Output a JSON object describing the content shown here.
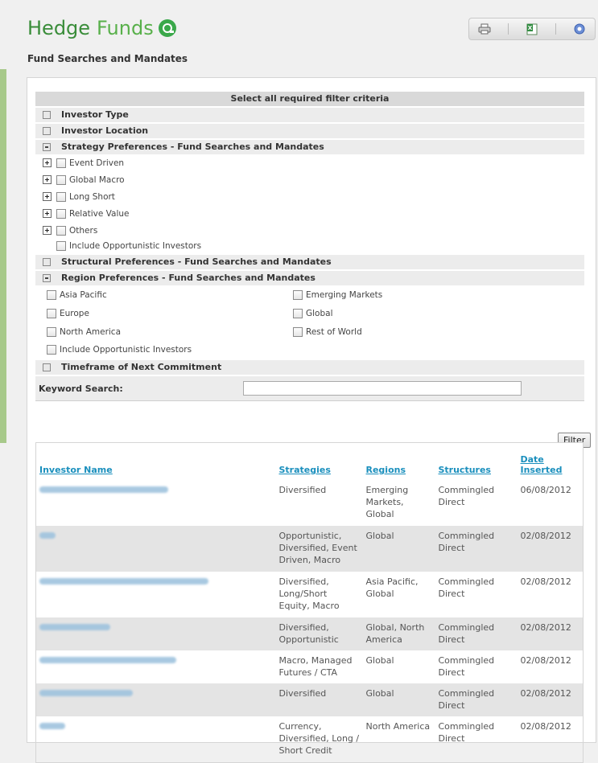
{
  "header": {
    "logo_main": "Hedge",
    "logo_light": "Funds",
    "subtitle": "Fund Searches and Mandates",
    "toolbar": {
      "print_icon": "printer-icon",
      "export_icon": "excel-icon",
      "help_icon": "help-icon"
    }
  },
  "filters": {
    "heading": "Select all required filter criteria",
    "investor_type": "Investor Type",
    "investor_location": "Investor Location",
    "strategy": {
      "label": "Strategy Preferences - Fund Searches and Mandates",
      "items": [
        "Event Driven",
        "Global Macro",
        "Long Short",
        "Relative Value",
        "Others"
      ],
      "include_opportunistic": "Include Opportunistic Investors"
    },
    "structural": "Structural Preferences - Fund Searches and Mandates",
    "region": {
      "label": "Region Preferences - Fund Searches and Mandates",
      "left": [
        "Asia Pacific",
        "Europe",
        "North America"
      ],
      "right": [
        "Emerging Markets",
        "Global",
        "Rest of World"
      ],
      "include_opportunistic": "Include Opportunistic Investors"
    },
    "timeframe": "Timeframe of Next Commitment",
    "keyword_label": "Keyword Search:",
    "keyword_value": "",
    "filter_button": "Filter"
  },
  "results": {
    "columns": [
      "Investor Name",
      "Strategies",
      "Regions",
      "Structures",
      "Date Inserted"
    ],
    "rows": [
      {
        "strategies": "Diversified",
        "regions": "Emerging Markets, Global",
        "structures": "Commingled Direct",
        "date": "06/08/2012"
      },
      {
        "strategies": "Opportunistic, Diversified, Event Driven, Macro",
        "regions": "Global",
        "structures": "Commingled Direct",
        "date": "02/08/2012"
      },
      {
        "strategies": "Diversified, Long/Short Equity, Macro",
        "regions": "Asia Pacific, Global",
        "structures": "Commingled Direct",
        "date": "02/08/2012"
      },
      {
        "strategies": "Diversified, Opportunistic",
        "regions": "Global, North America",
        "structures": "Commingled Direct",
        "date": "02/08/2012"
      },
      {
        "strategies": "Macro, Managed Futures / CTA",
        "regions": "Global",
        "structures": "Commingled Direct",
        "date": "02/08/2012"
      },
      {
        "strategies": "Diversified",
        "regions": "Global",
        "structures": "Commingled Direct",
        "date": "02/08/2012"
      },
      {
        "strategies": "Currency, Diversified, Long / Short Credit",
        "regions": "North America",
        "structures": "Commingled Direct",
        "date": "02/08/2012"
      }
    ]
  },
  "colors": {
    "brand_green": "#3a8d3a",
    "link_blue": "#1a8fbd",
    "accent_green": "#a7c98a"
  }
}
